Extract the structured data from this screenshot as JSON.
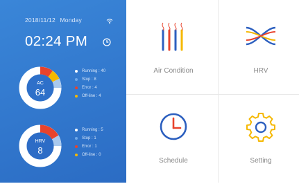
{
  "header": {
    "date": "2018/11/12",
    "weekday": "Monday",
    "time": "02:24 PM",
    "wifi_icon": "wifi-icon",
    "alarm_icon": "clock-icon"
  },
  "ac_panel": {
    "name": "AC",
    "value": "64",
    "legend": [
      {
        "label": "Running : 40",
        "color": "#ffffff"
      },
      {
        "label": "Stop : 8",
        "color": "#6fa8e8"
      },
      {
        "label": "Error : 4",
        "color": "#e8432c"
      },
      {
        "label": "Off-line : 4",
        "color": "#f5b800"
      }
    ]
  },
  "hrv_panel": {
    "name": "HRV",
    "value": "8",
    "legend": [
      {
        "label": "Running : 5",
        "color": "#ffffff"
      },
      {
        "label": "Stop : 1",
        "color": "#6fa8e8"
      },
      {
        "label": "Error : 1",
        "color": "#e8432c"
      },
      {
        "label": "Off-line : 0",
        "color": "#f5b800"
      }
    ]
  },
  "menu": {
    "air_condition": "Air Condition",
    "hrv": "HRV",
    "schedule": "Schedule",
    "setting": "Setting"
  },
  "colors": {
    "panel_blue": "#2f76cf",
    "accent_red": "#e8432c",
    "accent_yellow": "#f5b800",
    "accent_blue": "#2c5fbf"
  }
}
